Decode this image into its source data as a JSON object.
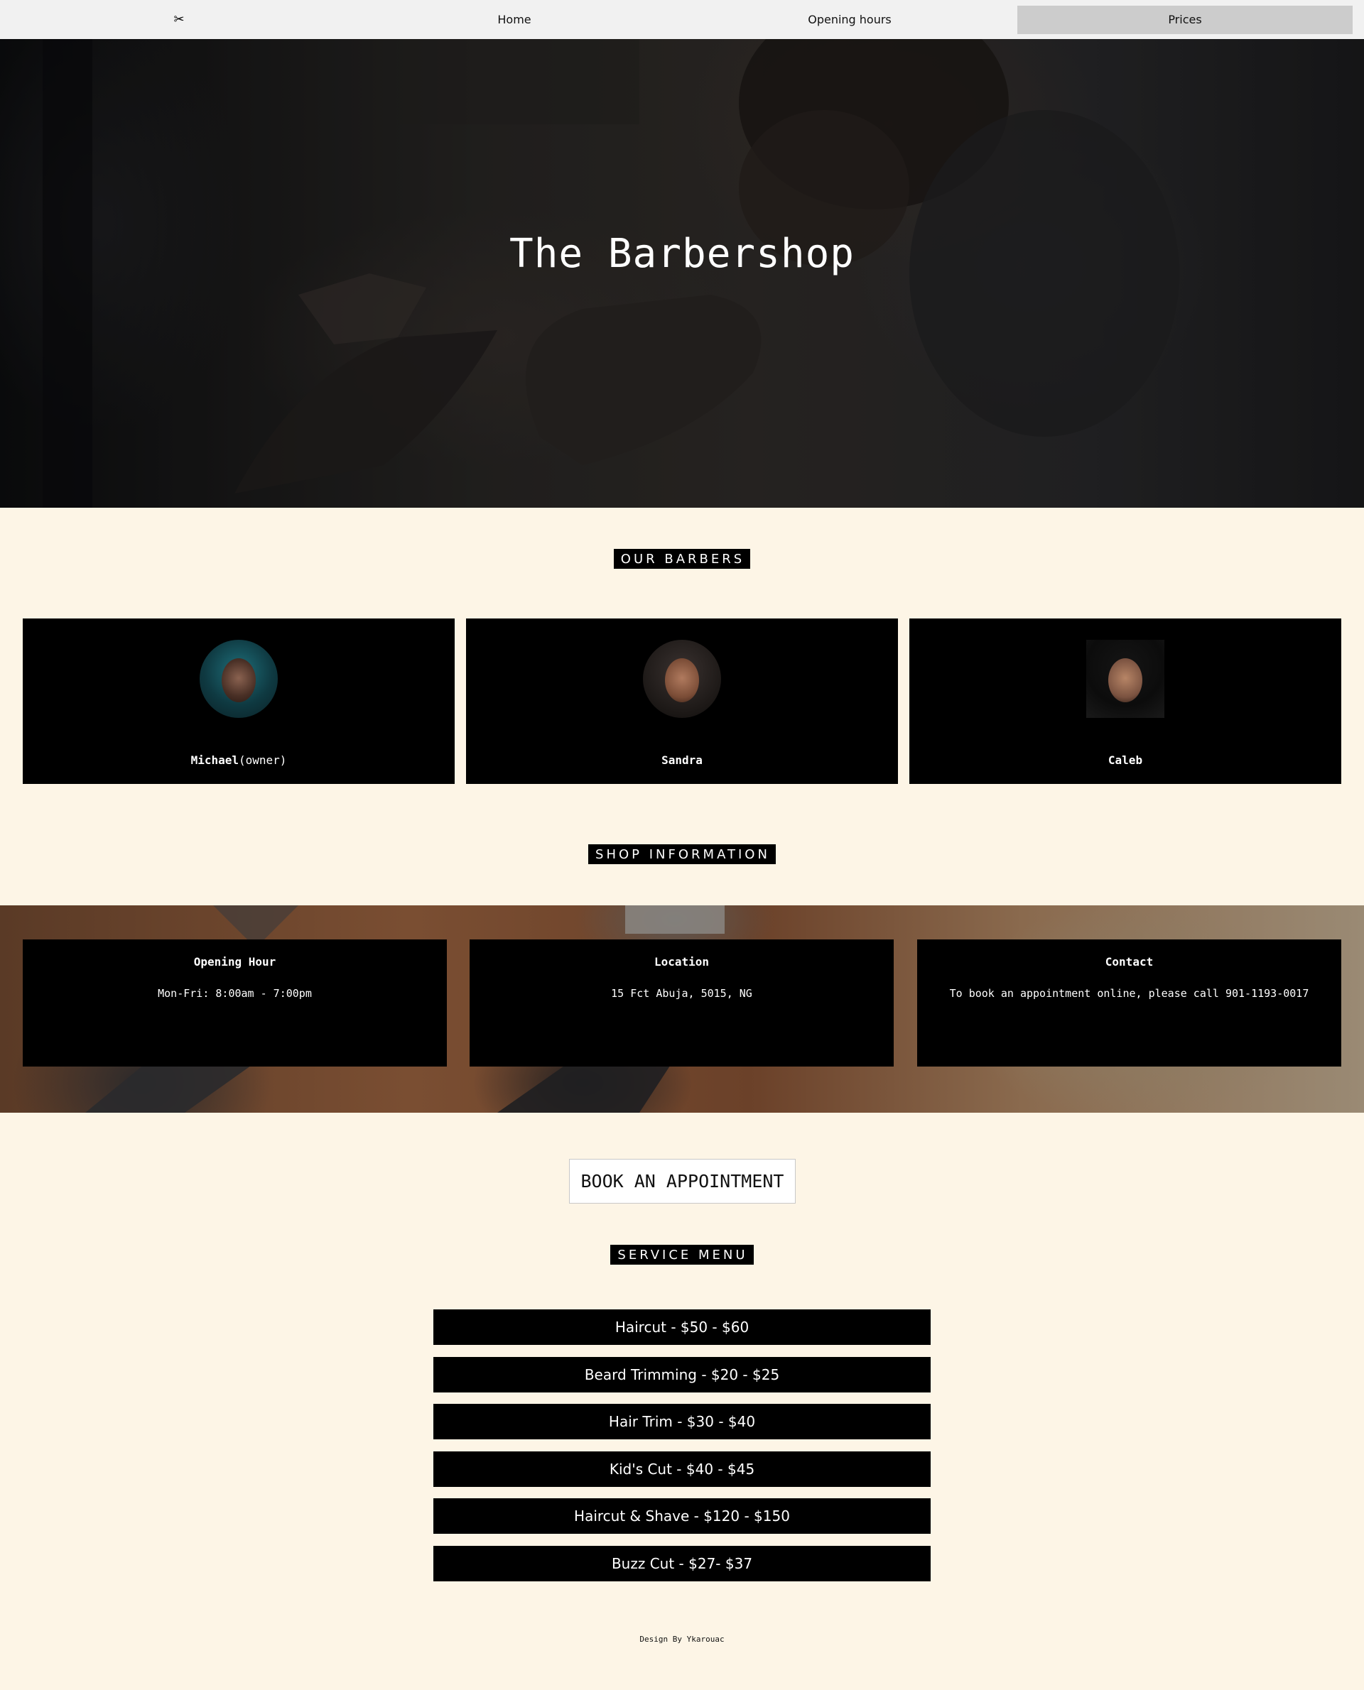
{
  "nav": {
    "logo_icon": "scissors-icon",
    "logo_glyph": "✂",
    "items": [
      {
        "label": "Home"
      },
      {
        "label": "Opening hours"
      },
      {
        "label": "Prices"
      }
    ],
    "active_item": "Prices"
  },
  "hero": {
    "title": "The Barbershop"
  },
  "barbers": {
    "section_label": "OUR BARBERS",
    "items": [
      {
        "name": "Michael",
        "role": "(owner)"
      },
      {
        "name": "Sandra",
        "role": ""
      },
      {
        "name": "Caleb",
        "role": ""
      }
    ]
  },
  "shop_info": {
    "section_label": "SHOP INFORMATION",
    "cards": [
      {
        "title": "Opening Hour",
        "text": "Mon-Fri: 8:00am - 7:00pm"
      },
      {
        "title": "Location",
        "text": "15 Fct Abuja, 5015, NG"
      },
      {
        "title": "Contact",
        "text": "To book an appointment online, please call 901-1193-0017"
      }
    ]
  },
  "booking": {
    "button_label": "BOOK AN APPOINTMENT"
  },
  "services": {
    "section_label": "SERVICE MENU",
    "items": [
      "Haircut - $50 - $60",
      "Beard Trimming - $20 - $25",
      "Hair Trim - $30 - $40",
      "Kid's Cut - $40 - $45",
      "Haircut & Shave - $120 - $150",
      "Buzz Cut - $27- $37"
    ]
  },
  "footer": {
    "text": "Design By Ykarouac"
  },
  "colors": {
    "page_background": "#fdf5e6",
    "nav_background": "#f1f1f1",
    "nav_active": "#cccccc",
    "card_background": "#000000"
  }
}
